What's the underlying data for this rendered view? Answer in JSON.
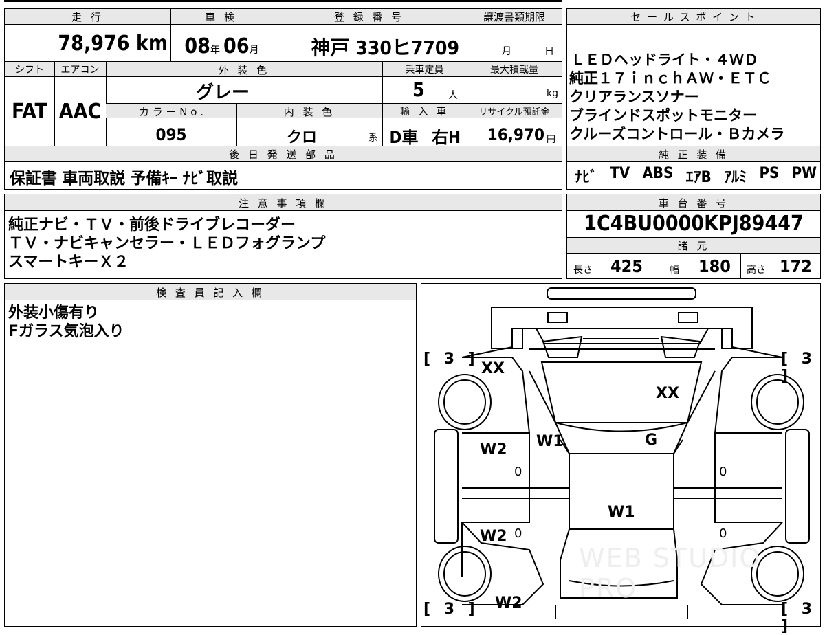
{
  "top_section": {
    "headers": {
      "mileage": "走 行",
      "inspection": "車 検",
      "registration": "登 録 番 号",
      "transfer_deadline": "譲渡書類期限"
    },
    "mileage": "78,976 km",
    "inspection_year": "08",
    "inspection_year_unit": "年",
    "inspection_month": "06",
    "inspection_month_unit": "月",
    "registration_number": "神戸 330ヒ7709",
    "transfer_month_unit": "月",
    "transfer_day_unit": "日",
    "shift_header": "シフト",
    "aircon_header": "エアコン",
    "exterior_color_header": "外 装 色",
    "capacity_header": "乗車定員",
    "max_load_header": "最大積載量",
    "shift": "FAT",
    "aircon": "AAC",
    "exterior_color": "グレー",
    "capacity": "5",
    "capacity_unit": "人",
    "max_load_unit": "kg",
    "color_no_header": "カ ラ ー N o .",
    "interior_color_header": "内 装 色",
    "import_header": "輸 入 車",
    "recycle_header": "リサイクル預託金",
    "color_no": "095",
    "interior_color": "クロ",
    "interior_color_suffix": "系",
    "import_type": "D車",
    "steering": "右H",
    "recycle_fee": "16,970",
    "recycle_unit": "円",
    "later_parts_header": "後 日 発 送 部 品",
    "later_parts": "保証書 車両取説 予備ｷｰ ﾅﾋﾞ取説"
  },
  "sales_points": {
    "header": "セ ー ル ス ポ イ ン ト",
    "lines": [
      "ＬＥＤヘッドライト・４ＷＤ",
      "純正１７ｉｎｃｈＡＷ・ＥＴＣ",
      "クリアランスソナー",
      "ブラインドスポットモニター",
      "クルーズコントロール・Ｂカメラ"
    ]
  },
  "equipment": {
    "header": "純 正 装 備",
    "items": [
      "ﾅﾋﾞ",
      "TV",
      "ABS",
      "ｴｱB",
      "ｱﾙﾐ",
      "PS",
      "PW"
    ]
  },
  "notes": {
    "header": "注 意 事 項 欄",
    "lines": [
      "純正ナビ・ＴＶ・前後ドライブレコーダー",
      "ＴＶ・ナビキャンセラー・ＬＥＤフォグランプ",
      "スマートキーＸ２"
    ]
  },
  "chassis": {
    "header": "車 台 番 号",
    "number": "1C4BU0000KPJ89447",
    "specs_header": "諸 元",
    "length_label": "長さ",
    "length": "425",
    "width_label": "幅",
    "width": "180",
    "height_label": "高さ",
    "height": "172"
  },
  "inspector": {
    "header": "検 査 員 記 入 欄",
    "lines": [
      "外装小傷有り",
      "Fガラス気泡入り"
    ]
  },
  "diagram": {
    "brackets": [
      "[ 3 ]",
      "[ 3 ]",
      "[ 3 ]",
      "[ 3 ]"
    ],
    "marks": {
      "xx_front_left": "XX",
      "xx_windshield": "XX",
      "w1_left": "W1",
      "g_right": "G",
      "w2_front_door": "W2",
      "w1_roof": "W1",
      "w2_rear_door": "W2",
      "w2_rear": "W2",
      "zero_1": "0",
      "zero_2": "0",
      "zero_3": "0",
      "zero_4": "0"
    },
    "watermark": "WEB STUDIO PRO"
  }
}
